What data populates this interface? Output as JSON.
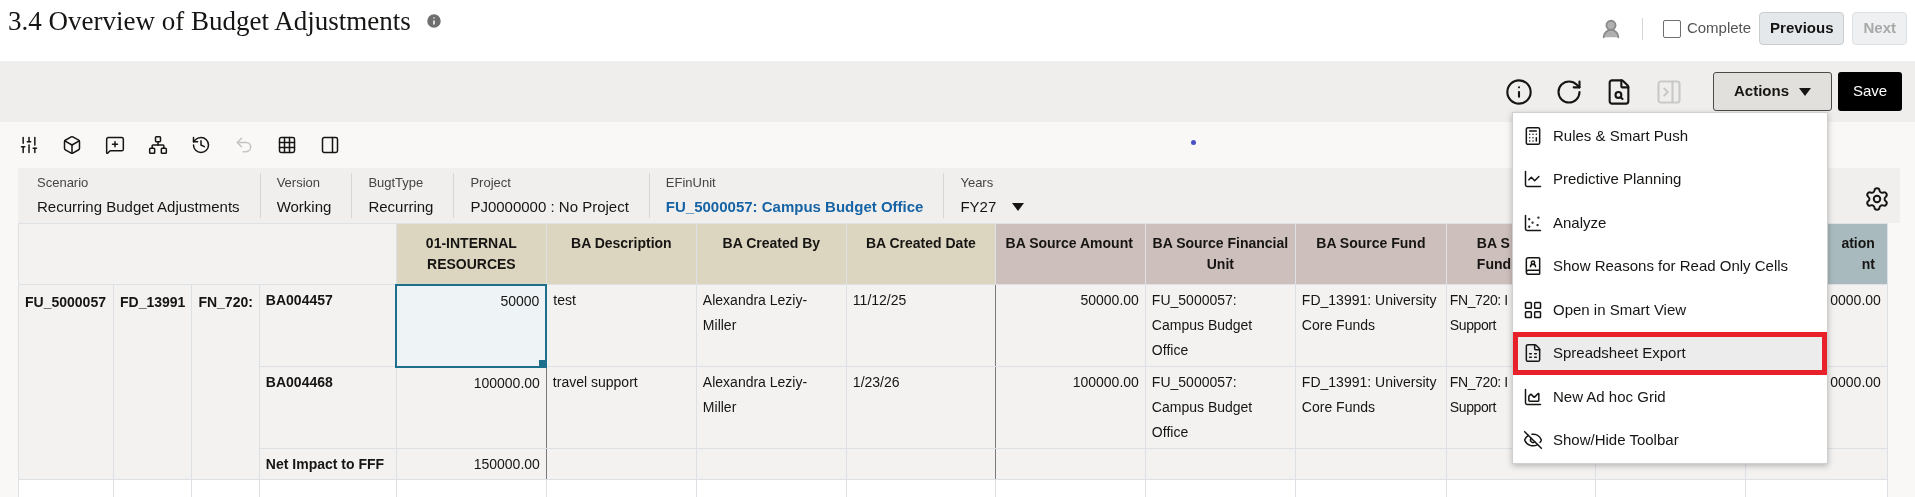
{
  "page": {
    "title": "3.4 Overview of Budget Adjustments"
  },
  "header_actions": {
    "complete": {
      "label": "Complete",
      "checked": false
    },
    "previous": {
      "label": "Previous",
      "disabled": false
    },
    "next": {
      "label": "Next",
      "disabled": true
    }
  },
  "toolbar": [
    {
      "kind": "adjust",
      "disabled": false
    },
    {
      "kind": "cube",
      "disabled": false
    },
    {
      "kind": "comment",
      "disabled": false
    },
    {
      "kind": "hierarchy",
      "disabled": false
    },
    {
      "kind": "history",
      "disabled": false
    },
    {
      "kind": "undo",
      "disabled": true
    },
    {
      "kind": "grid",
      "disabled": false
    },
    {
      "kind": "panel",
      "disabled": false
    }
  ],
  "grid_toolbar": {
    "icons": [
      {
        "kind": "info",
        "disabled": false
      },
      {
        "kind": "refresh",
        "disabled": false
      },
      {
        "kind": "inspect",
        "disabled": false
      },
      {
        "kind": "collapse",
        "disabled": true
      }
    ],
    "actions": {
      "label": "Actions",
      "expanded": true
    },
    "save": {
      "label": "Save"
    }
  },
  "pov": [
    {
      "label": "Scenario",
      "value": "Recurring Budget Adjustments",
      "kind": "text"
    },
    {
      "label": "Version",
      "value": "Working",
      "kind": "text"
    },
    {
      "label": "BugtType",
      "value": "Recurring",
      "kind": "text"
    },
    {
      "label": "Project",
      "value": "PJ0000000 : No Project",
      "kind": "text"
    },
    {
      "label": "EFinUnit",
      "value": "FU_5000057: Campus Budget Office",
      "kind": "link"
    },
    {
      "label": "Years",
      "value": "FY27",
      "kind": "dropdown"
    }
  ],
  "table": {
    "columns": [
      {
        "label": "01-INTERNAL RESOURCES",
        "kind": "number",
        "color": "#dcd6c0"
      },
      {
        "label": "BA Description",
        "kind": "text",
        "color": "#dcd6c0"
      },
      {
        "label": "BA Created By",
        "kind": "text",
        "color": "#dcd6c0"
      },
      {
        "label": "BA Created Date",
        "kind": "text",
        "color": "#dcd6c0"
      },
      {
        "label": "BA Source Amount",
        "kind": "number",
        "color": "#cdbfbb"
      },
      {
        "label": "BA Source Financial Unit",
        "kind": "text",
        "color": "#cdbfbb"
      },
      {
        "label": "BA Source Fund",
        "kind": "text",
        "color": "#cdbfbb"
      },
      {
        "label": "BA S\nFund",
        "kind": "clipped",
        "color": "#cdbfbb"
      },
      {
        "kind": "covered"
      },
      {
        "label": "ation\nnt",
        "kind": "number",
        "color": "#a8babd"
      }
    ],
    "rows": [
      {
        "members": [
          "FU_5000057",
          "FD_13991",
          "FN_720:"
        ],
        "label": "BA004457",
        "cells": [
          {
            "text": "50000",
            "selected": true
          },
          {
            "text": "test",
            "selected": false
          },
          {
            "text": "Alexandra Leziy-Miller",
            "selected": false
          },
          {
            "text": "11/12/25",
            "selected": false
          },
          {
            "text": "50000.00",
            "selected": false
          },
          {
            "text": "FU_5000057: Campus Budget Office",
            "selected": false
          },
          {
            "text": "FD_13991: University Core Funds",
            "selected": false
          },
          {
            "text": "FN_720: I\nSupport",
            "selected": false
          },
          null,
          {
            "text": "0000.00",
            "selected": false
          }
        ]
      },
      {
        "label": "BA004468",
        "cells": [
          {
            "text": "100000.00",
            "selected": false
          },
          {
            "text": "travel support",
            "selected": false
          },
          {
            "text": "Alexandra Leziy-Miller",
            "selected": false
          },
          {
            "text": "1/23/26",
            "selected": false
          },
          {
            "text": "100000.00",
            "selected": false
          },
          {
            "text": "FU_5000057: Campus Budget Office",
            "selected": false
          },
          {
            "text": "FD_13991: University Core Funds",
            "selected": false
          },
          {
            "text": "FN_720: I\nSupport",
            "selected": false
          },
          null,
          {
            "text": "0000.00",
            "selected": false
          }
        ]
      },
      {
        "label": "Net Impact to FFF",
        "cells": [
          {
            "text": "150000.00",
            "selected": false
          },
          null,
          null,
          null,
          null,
          null,
          null,
          null,
          null,
          null
        ]
      }
    ]
  },
  "actions_menu": [
    {
      "label": "Rules & Smart Push",
      "kind": "rules",
      "selected": false
    },
    {
      "label": "Predictive Planning",
      "kind": "predictive",
      "selected": false
    },
    {
      "label": "Analyze",
      "kind": "analyze",
      "selected": false
    },
    {
      "label": "Show Reasons for Read Only Cells",
      "kind": "reasons",
      "selected": false
    },
    {
      "label": "Open in Smart View",
      "kind": "smartview",
      "selected": false
    },
    {
      "label": "Spreadsheet Export",
      "kind": "export",
      "selected": true
    },
    {
      "label": "New Ad hoc Grid",
      "kind": "adhoc",
      "selected": false
    },
    {
      "label": "Show/Hide Toolbar",
      "kind": "toolbar",
      "selected": false
    }
  ]
}
